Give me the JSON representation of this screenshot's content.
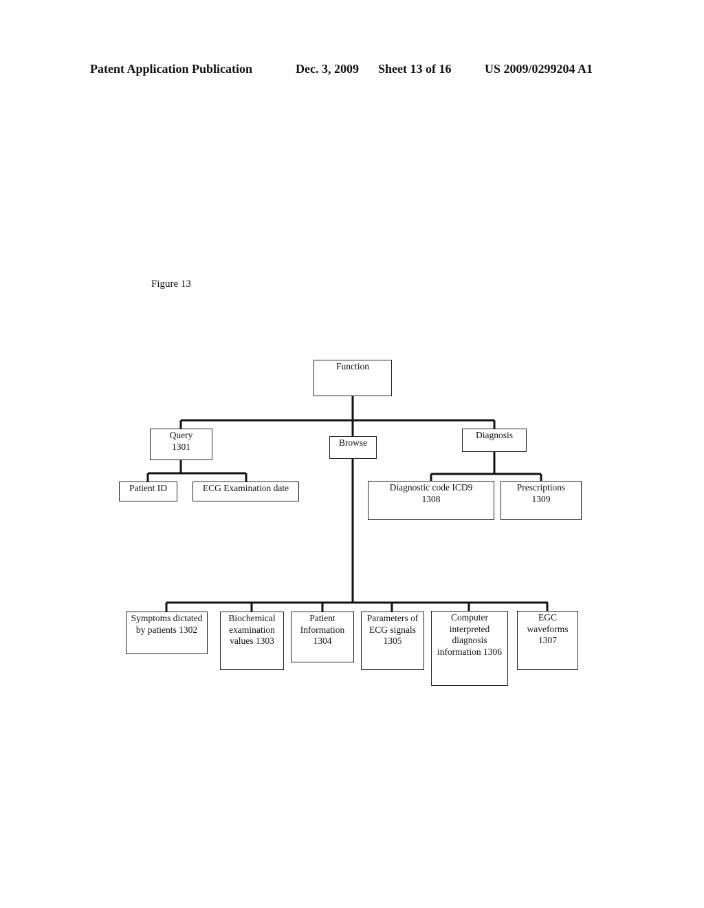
{
  "header": {
    "publication": "Patent Application Publication",
    "date": "Dec. 3, 2009",
    "sheet": "Sheet 13 of 16",
    "number": "US 2009/0299204 A1"
  },
  "figure_label": "Figure 13",
  "diagram": {
    "root": {
      "label": "Function"
    },
    "query": {
      "label": "Query",
      "ref": "1301",
      "children": [
        {
          "label": "Patient ID"
        },
        {
          "label": "ECG Examination date"
        }
      ]
    },
    "browse": {
      "label": "Browse",
      "children": [
        {
          "line1": "Symptoms dictated",
          "line2": "by patients 1302"
        },
        {
          "line1": "Biochemical",
          "line2": "examination",
          "line3": "values 1303"
        },
        {
          "line1": "Patient",
          "line2": "Information",
          "line3": "1304"
        },
        {
          "line1": "Parameters of",
          "line2": "ECG signals",
          "line3": "1305"
        },
        {
          "line1": "Computer",
          "line2": "interpreted",
          "line3": "diagnosis",
          "line4": "information 1306"
        },
        {
          "line1": "EGC",
          "line2": "waveforms",
          "line3": "1307"
        }
      ]
    },
    "diagnosis": {
      "label": "Diagnosis",
      "children": [
        {
          "label": "Diagnostic code ICD9",
          "ref": "1308"
        },
        {
          "label": "Prescriptions",
          "ref": "1309"
        }
      ]
    }
  }
}
